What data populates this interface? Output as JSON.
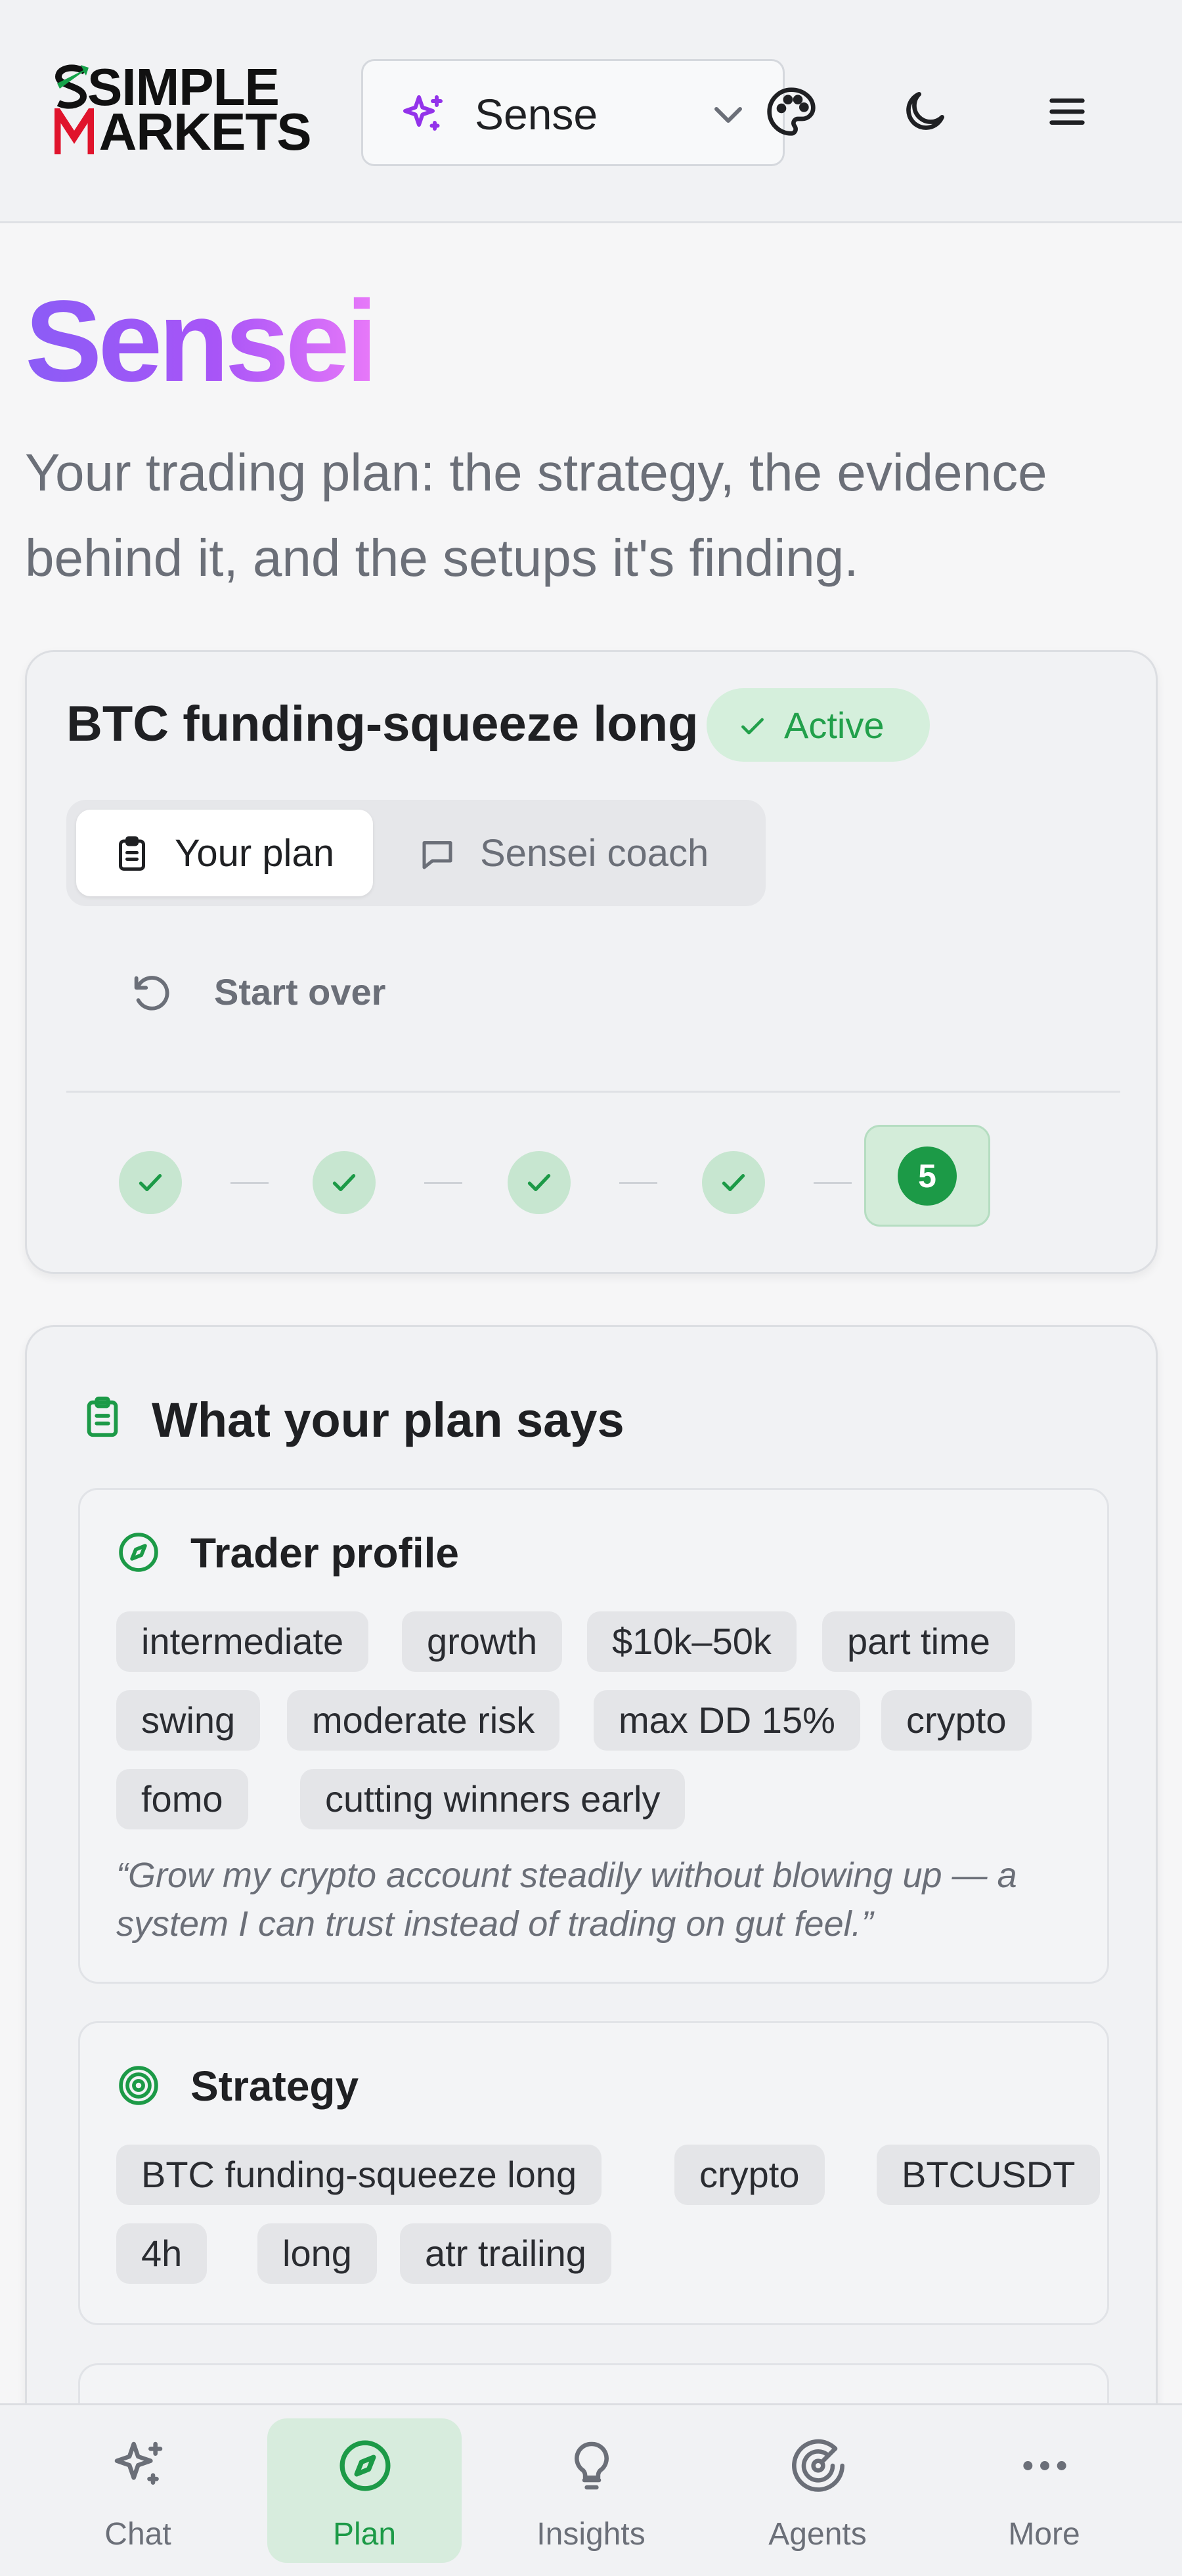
{
  "header": {
    "logo_line1": "SIMPLE",
    "logo_line2": "MARKETS",
    "model_selector": {
      "label": "Sense",
      "icon": "sparkles-icon"
    },
    "buttons": [
      {
        "name": "theme-palette-button",
        "icon": "palette-icon"
      },
      {
        "name": "dark-mode-button",
        "icon": "moon-icon"
      },
      {
        "name": "menu-button",
        "icon": "hamburger-icon"
      }
    ]
  },
  "intro": {
    "title": "Sensei",
    "subtitle": "Your trading plan: the strategy, the evidence behind it, and the setups it's finding."
  },
  "plan_card": {
    "name": "BTC funding-squeeze long",
    "status": "Active",
    "tabs": [
      {
        "label": "Your plan",
        "icon": "clipboard-icon",
        "active": true
      },
      {
        "label": "Sensei coach",
        "icon": "message-square-icon",
        "active": false
      }
    ],
    "start_over_label": "Start over",
    "steps": {
      "total": 5,
      "completed": 4,
      "current_label": "5"
    }
  },
  "plan_summary": {
    "title": "What your plan says",
    "sections": [
      {
        "title": "Trader profile",
        "icon": "compass-icon",
        "tags": [
          "intermediate",
          "growth",
          "$10k–50k",
          "part time",
          "swing",
          "moderate risk",
          "max DD 15%",
          "crypto",
          "fomo",
          "cutting winners early"
        ],
        "quote": "“Grow my crypto account steadily without blowing up — a system I can trust instead of trading on gut feel.”"
      },
      {
        "title": "Strategy",
        "icon": "target-icon",
        "tags": [
          "BTC funding-squeeze long",
          "crypto",
          "BTCUSDT",
          "4h",
          "long",
          "atr trailing"
        ]
      }
    ]
  },
  "bottom_nav": [
    {
      "label": "Chat",
      "icon": "sparkles-icon",
      "active": false
    },
    {
      "label": "Plan",
      "icon": "compass-icon",
      "active": true
    },
    {
      "label": "Insights",
      "icon": "lightbulb-icon",
      "active": false
    },
    {
      "label": "Agents",
      "icon": "radar-icon",
      "active": false
    },
    {
      "label": "More",
      "icon": "more-horizontal-icon",
      "active": false
    }
  ],
  "colors": {
    "accent_green": "#1c9a47",
    "title_gradient_start": "#8b5cf6",
    "title_gradient_end": "#e879f9",
    "logo_red": "#e0142c",
    "logo_green": "#15a34a",
    "spark_purple": "#9333ea"
  }
}
